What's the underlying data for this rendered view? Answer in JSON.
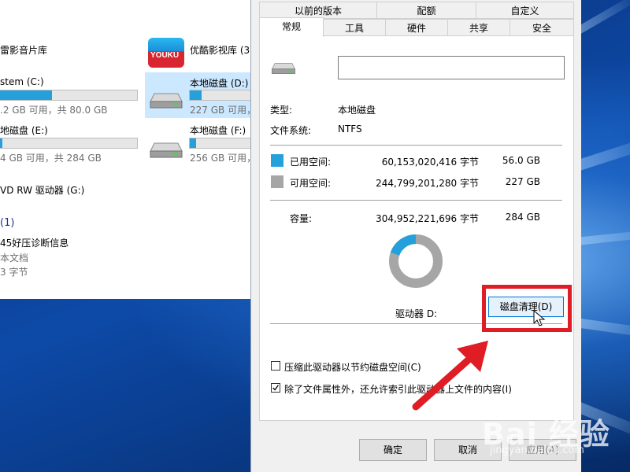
{
  "explorer": {
    "items": [
      {
        "name": "雷影音片库"
      },
      {
        "name": "优酷影视库 (3",
        "logo_text": "YOUKU"
      },
      {
        "name": "stem (C:)",
        "info": ".2 GB 可用，共 80.0 GB",
        "used_fraction": 0.38
      },
      {
        "name": "本地磁盘 (D:)",
        "info": "227 GB 可用，共 284 GB",
        "used_fraction": 0.2
      },
      {
        "name": "地磁盘 (E:)",
        "info": "4 GB 可用，共 284 GB",
        "used_fraction": 0.02
      },
      {
        "name": "本地磁盘 (F:)",
        "info": "256 GB 可用，共 284 GB",
        "used_fraction": 0.1
      },
      {
        "name": "VD RW 驱动器 (G:)"
      }
    ],
    "group_header": "(1)",
    "file": {
      "name": "45好压诊断信息",
      "type": "本文档",
      "size": "3 字节"
    }
  },
  "dialog": {
    "tabs_top": [
      "以前的版本",
      "配额",
      "自定义"
    ],
    "tabs_bottom": [
      "常规",
      "工具",
      "硬件",
      "共享",
      "安全"
    ],
    "name_value": "",
    "type_label": "类型:",
    "type_value": "本地磁盘",
    "fs_label": "文件系统:",
    "fs_value": "NTFS",
    "used": {
      "label": "已用空间:",
      "bytes": "60,153,020,416 字节",
      "size": "56.0 GB",
      "color": "#26a0da"
    },
    "free": {
      "label": "可用空间:",
      "bytes": "244,799,201,280 字节",
      "size": "227 GB",
      "color": "#a6a6a6"
    },
    "capacity": {
      "label": "容量:",
      "bytes": "304,952,221,696 字节",
      "size": "284 GB"
    },
    "used_fraction": 0.197,
    "drive_label": "驱动器 D:",
    "cleanup_button": "磁盘清理(D)",
    "compress_option": "压缩此驱动器以节约磁盘空间(C)",
    "compress_checked": false,
    "index_option": "除了文件属性外，还允许索引此驱动器上文件的内容(I)",
    "index_checked": true,
    "ok_button": "确定",
    "cancel_button": "取消",
    "apply_button": "应用(A)"
  },
  "watermark": {
    "brand": "Bai 经验",
    "url": "jingyan.baidu.com"
  },
  "colors": {
    "highlight": "#e01c24",
    "accent": "#26a0da"
  }
}
